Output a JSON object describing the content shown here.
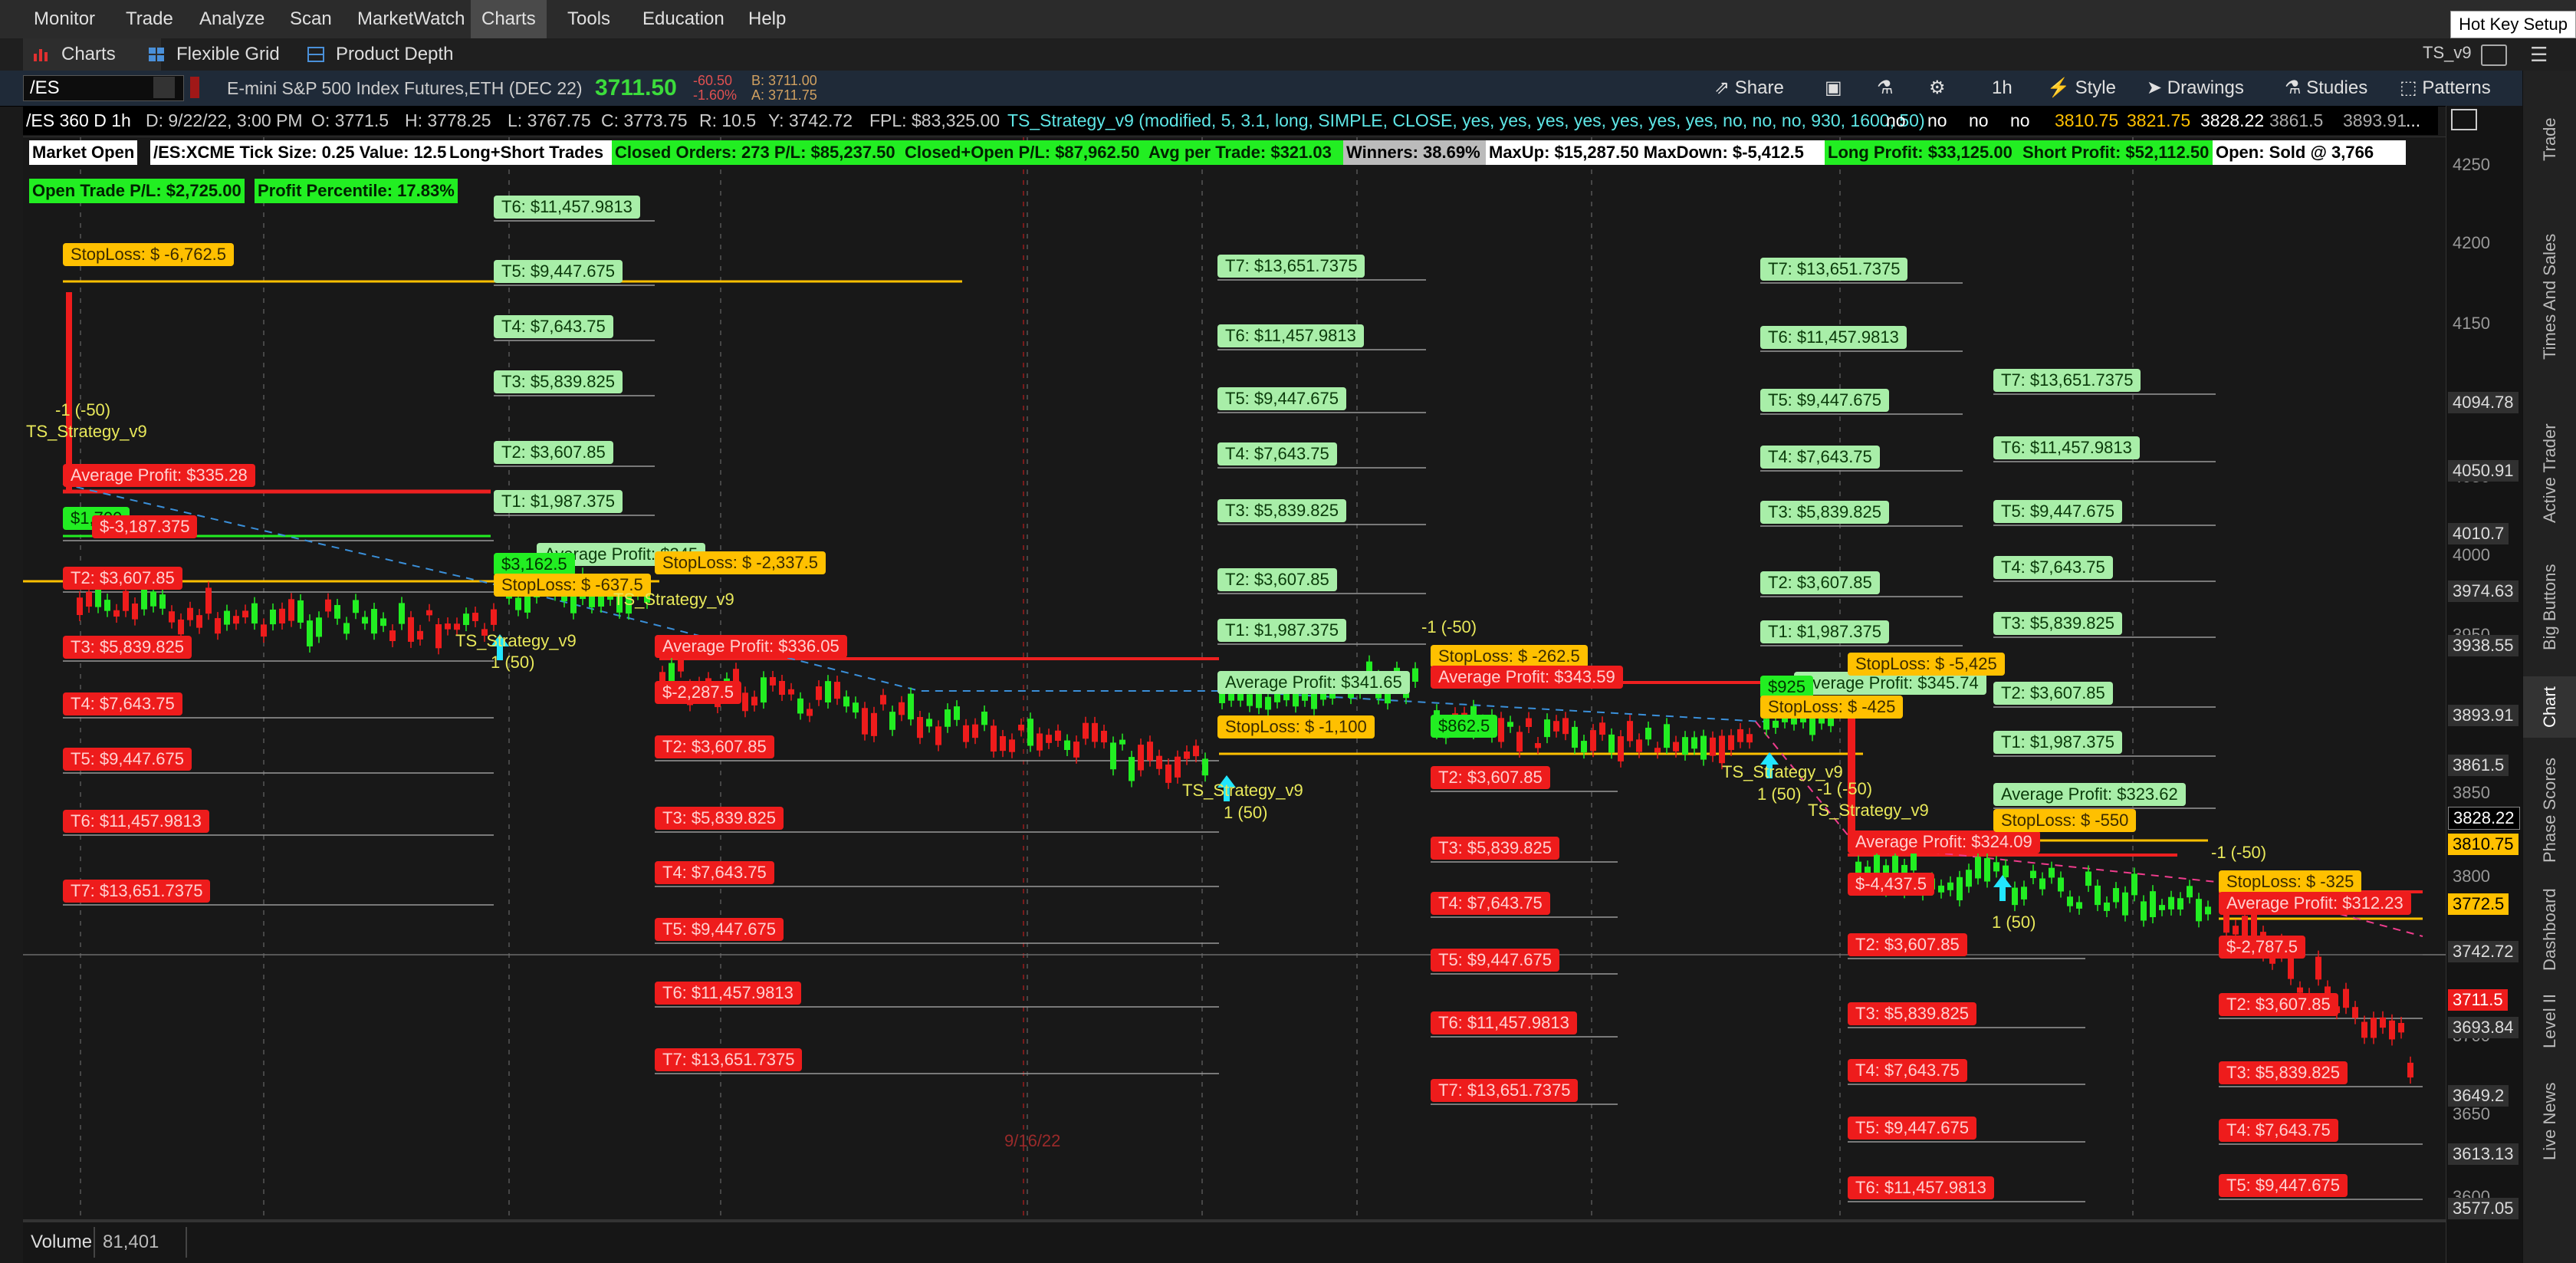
{
  "menu": [
    "Monitor",
    "Trade",
    "Analyze",
    "Scan",
    "MarketWatch",
    "Charts",
    "Tools",
    "Education",
    "Help"
  ],
  "hotkey": "Hot Key Setup",
  "subtabs": {
    "charts": "Charts",
    "flexible_grid": "Flexible Grid",
    "product_depth": "Product Depth"
  },
  "window_title": "TS_v9",
  "symbol": {
    "ticker": "/ES",
    "name": "E-mini S&P 500 Index Futures,ETH (DEC 22)",
    "last": "3711.50",
    "change": "-60.50",
    "change_pct": "-1.60%",
    "bid": "B: 3711.00",
    "ask": "A: 3711.75"
  },
  "toolbar": {
    "share": "Share",
    "interval": "1h",
    "style": "Style",
    "drawings": "Drawings",
    "studies": "Studies",
    "patterns": "Patterns"
  },
  "info": {
    "label": "/ES 360 D 1h",
    "date": "D: 9/22/22, 3:00 PM",
    "open": "O: 3771.5",
    "high": "H: 3778.25",
    "low": "L: 3767.75",
    "close": "C: 3773.75",
    "range": "R: 10.5",
    "y": "Y: 3742.72",
    "fpl": "FPL: $83,325.00",
    "strategy": "TS_Strategy_v9 (modified, 5, 3.1, long, SIMPLE, CLOSE, yes, yes, yes, yes, yes, yes, yes, no, no, no, 930, 1600, 50)",
    "flags": [
      "no",
      "no",
      "no",
      "no"
    ],
    "v1": "3810.75",
    "v2": "3821.75",
    "v3": "3828.22",
    "v4": "3861.5",
    "v5": "3893.91",
    "more": "..."
  },
  "stats_row1": [
    "Market Open",
    "/ES:XCME Tick Size: 0.25 Value: 12.5",
    "Long+Short Trades",
    "Closed Orders: 273 P/L: $85,237.50",
    "Closed+Open P/L: $87,962.50",
    "Avg per Trade: $321.03",
    "Winners: 38.69%",
    "MaxUp: $15,287.50 MaxDown: $-5,412.5",
    "Long Profit: $33,125.00",
    "Short Profit: $52,112.50",
    "Open: Sold @ 3,766"
  ],
  "stats_row2": [
    "Open Trade P/L: $2,725.00",
    "Profit Percentile: 17.83%"
  ],
  "axis": {
    "ticks": [
      "4250",
      "4200",
      "4150",
      "4050",
      "4000",
      "3950",
      "3900",
      "3850",
      "3800",
      "3750",
      "3700",
      "3650",
      "3600"
    ],
    "boxes": [
      "4094.78",
      "4050.91",
      "4010.7",
      "3974.63",
      "3938.55",
      "3893.91",
      "3861.5",
      "3828.22",
      "3810.75",
      "3772.5",
      "3742.72",
      "3711.5",
      "3693.84",
      "3649.2",
      "3613.13",
      "3577.05"
    ]
  },
  "chart_labels": {
    "stoploss_1": "StopLoss: $ -6,762.5",
    "avg_1": "Average Profit: $335.28",
    "p_1700": "$1,700",
    "p_1_t1": "$-3,187.375",
    "p_1_t2": "T2: $3,607.85",
    "p_1_t3": "T3: $5,839.825",
    "p_1_t4": "T4: $7,643.75",
    "p_1_t5": "T5: $9,447.675",
    "p_1_t6": "T6: $11,457.9813",
    "p_1_t7": "T7: $13,651.7375",
    "g2_t6": "T6: $11,457.9813",
    "g2_t5": "T5: $9,447.675",
    "g2_t4": "T4: $7,643.75",
    "g2_t3": "T3: $5,839.825",
    "g2_t2": "T2: $3,607.85",
    "g2_t1": "T1: $1,987.375",
    "g2_avg": "Average Profit: $345",
    "g2_p": "$3,162.5",
    "g2_sl": "StopLoss: $ -637.5",
    "sl_3": "StopLoss: $ -2,337.5",
    "avg_3": "Average Profit: $336.05",
    "r3_p": "$-2,287.5",
    "r3_t2": "T2: $3,607.85",
    "r3_t3": "T3: $5,839.825",
    "r3_t4": "T4: $7,643.75",
    "r3_t5": "T5: $9,447.675",
    "r3_t6": "T6: $11,457.9813",
    "r3_t7": "T7: $13,651.7375",
    "g4_t7": "T7: $13,651.7375",
    "g4_t6": "T6: $11,457.9813",
    "g4_t5": "T5: $9,447.675",
    "g4_t4": "T4: $7,643.75",
    "g4_t3": "T3: $5,839.825",
    "g4_t2": "T2: $3,607.85",
    "g4_t1": "T1: $1,987.375",
    "g4_avg": "Average Profit: $341.65",
    "g4_sl": "StopLoss: $ -1,100",
    "sl_5": "StopLoss: $ -262.5",
    "avg_5": "Average Profit: $343.59",
    "p_5": "$862.5",
    "r5_t2": "T2: $3,607.85",
    "r5_t3": "T3: $5,839.825",
    "r5_t4": "T4: $7,643.75",
    "r5_t5": "T5: $9,447.675",
    "r5_t6": "T6: $11,457.9813",
    "r5_t7": "T7: $13,651.7375",
    "g6_t7": "T7: $13,651.7375",
    "g6_t6": "T6: $11,457.9813",
    "g6_t5": "T5: $9,447.675",
    "g6_t4": "T4: $7,643.75",
    "g6_t3": "T3: $5,839.825",
    "g6_t2": "T2: $3,607.85",
    "g6_t1": "T1: $1,987.375",
    "g6_avg": "Average Profit: $345.74",
    "g6_p": "$925",
    "g6_sl": "StopLoss: $ -425",
    "sl_7": "StopLoss: $ -5,425",
    "avg_7": "Average Profit: $324.09",
    "p_7": "$-4,437.5",
    "r7_t2": "T2: $3,607.85",
    "r7_t3": "T3: $5,839.825",
    "r7_t4": "T4: $7,643.75",
    "r7_t5": "T5: $9,447.675",
    "r7_t6": "T6: $11,457.9813",
    "g8_t7": "T7: $13,651.7375",
    "g8_t6": "T6: $11,457.9813",
    "g8_t5": "T5: $9,447.675",
    "g8_t4": "T4: $7,643.75",
    "g8_t3": "T3: $5,839.825",
    "g8_t2": "T2: $3,607.85",
    "g8_t1": "T1: $1,987.375",
    "g8_avg": "Average Profit: $323.62",
    "g8_sl": "StopLoss: $ -550",
    "sl_9": "StopLoss: $ -325",
    "avg_9": "Average Profit: $312.23",
    "p_9": "$-2,787.5",
    "r9_t2": "T2: $3,607.85",
    "r9_t3": "T3: $5,839.825",
    "r9_t4": "T4: $7,643.75",
    "r9_t5": "T5: $9,447.675"
  },
  "strategy_texts": {
    "name": "TS_Strategy_v9",
    "short": "-1 (-50)",
    "long": "1 (50)",
    "date": "9/16/22"
  },
  "volume": {
    "label": "Volume",
    "value": "81,401"
  },
  "sidebar_tabs": [
    "Trade",
    "Times And Sales",
    "Active Trader",
    "Big Buttons",
    "Chart",
    "Phase Scores",
    "Dashboard",
    "Level II",
    "Live News"
  ],
  "colors": {
    "green_label": "#a8eea8",
    "red_label": "#ee1c1c",
    "stoploss": "#ffc000",
    "up_candle": "#22ee22",
    "down_candle": "#ee1c1c",
    "strategy_text": "#e8e85a",
    "buy_arrow": "#22e6ff"
  }
}
